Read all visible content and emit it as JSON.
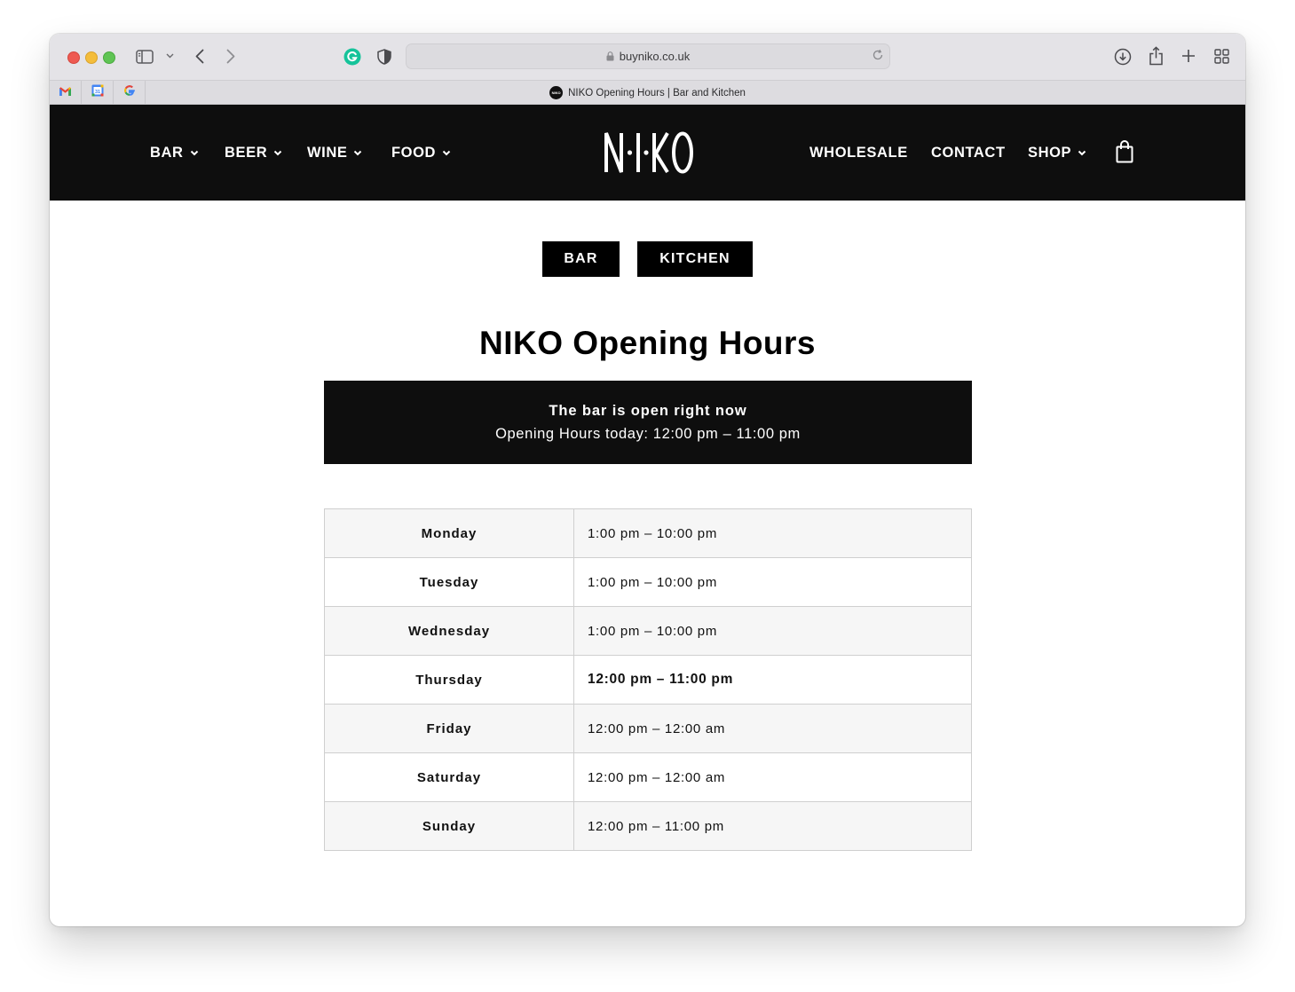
{
  "browser": {
    "url": "buyniko.co.uk",
    "tab_title": "NIKO Opening Hours | Bar and Kitchen",
    "pinned_tabs": [
      "gmail-icon",
      "google-calendar-icon",
      "google-icon"
    ]
  },
  "site": {
    "logo_text": "N·I·KO",
    "nav_left": [
      {
        "label": "BAR",
        "has_dropdown": true
      },
      {
        "label": "BEER",
        "has_dropdown": true
      },
      {
        "label": "WINE",
        "has_dropdown": true
      },
      {
        "label": "FOOD",
        "has_dropdown": true
      }
    ],
    "nav_right": [
      {
        "label": "WHOLESALE",
        "has_dropdown": false
      },
      {
        "label": "CONTACT",
        "has_dropdown": false
      },
      {
        "label": "SHOP",
        "has_dropdown": true
      }
    ]
  },
  "toggle": {
    "bar_label": "BAR",
    "kitchen_label": "KITCHEN"
  },
  "page": {
    "title": "NIKO Opening Hours",
    "status_main": "The bar is open right now",
    "status_sub": "Opening Hours today: 12:00 pm – 11:00 pm"
  },
  "hours": [
    {
      "day": "Monday",
      "hours": "1:00 pm – 10:00 pm",
      "today": false
    },
    {
      "day": "Tuesday",
      "hours": "1:00 pm – 10:00 pm",
      "today": false
    },
    {
      "day": "Wednesday",
      "hours": "1:00 pm – 10:00 pm",
      "today": false
    },
    {
      "day": "Thursday",
      "hours": "12:00 pm – 11:00 pm",
      "today": true
    },
    {
      "day": "Friday",
      "hours": "12:00 pm – 12:00 am",
      "today": false
    },
    {
      "day": "Saturday",
      "hours": "12:00 pm – 12:00 am",
      "today": false
    },
    {
      "day": "Sunday",
      "hours": "12:00 pm – 11:00 pm",
      "today": false
    }
  ],
  "colors": {
    "header_bg": "#0e0e0e",
    "button_bg": "#000000",
    "row_alt_bg": "#f6f6f6",
    "table_border": "#cfcfcf"
  }
}
